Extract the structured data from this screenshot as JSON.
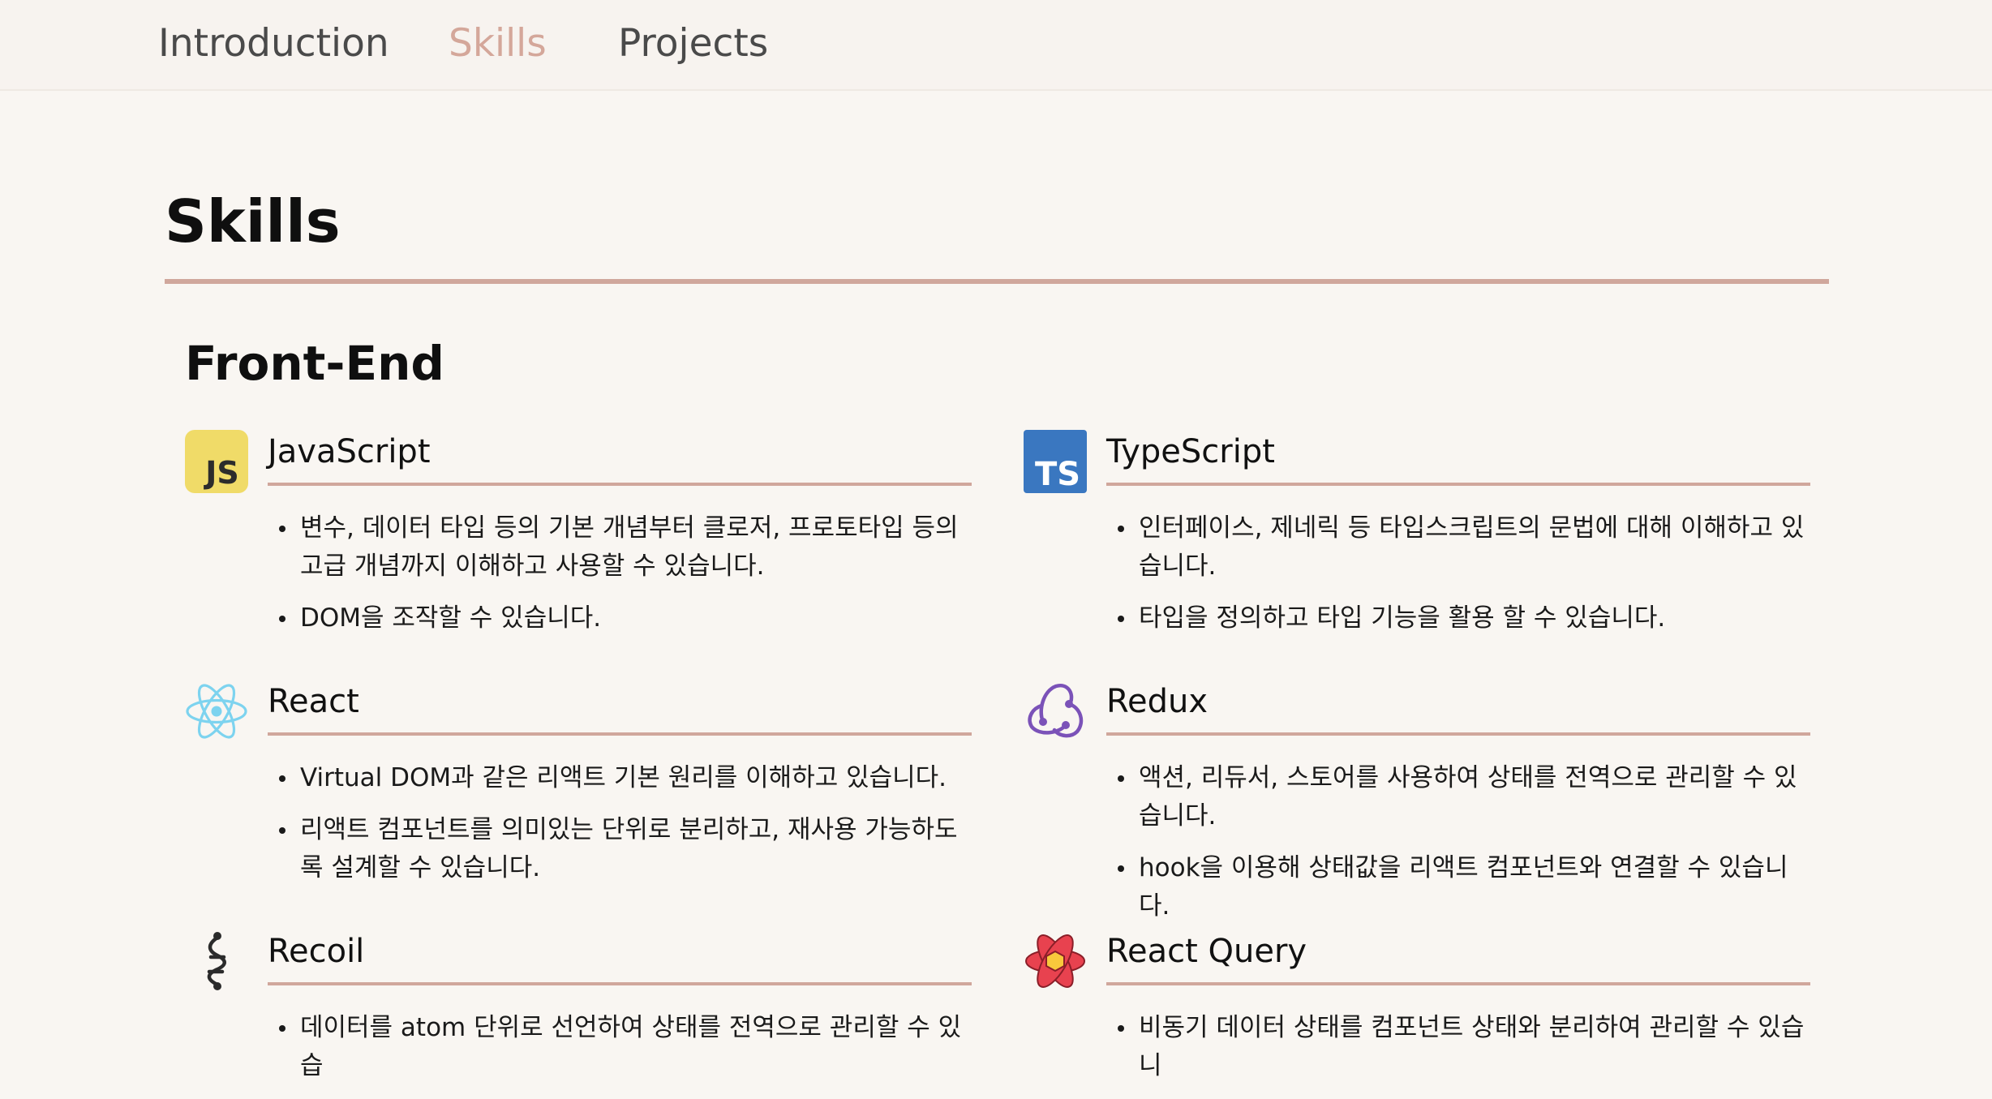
{
  "nav": {
    "items": [
      {
        "label": "Introduction"
      },
      {
        "label": "Skills"
      },
      {
        "label": "Projects"
      }
    ],
    "active_index": 1,
    "active_color": "#d4a79a"
  },
  "page": {
    "title": "Skills",
    "accent_color": "#d0a79c"
  },
  "sections": [
    {
      "title": "Front-End",
      "skills": [
        {
          "name": "JavaScript",
          "icon": "javascript-icon",
          "bullets": [
            "변수, 데이터 타입 등의 기본 개념부터 클로저, 프로토타입 등의 고급 개념까지 이해하고 사용할 수 있습니다.",
            "DOM을 조작할 수 있습니다."
          ]
        },
        {
          "name": "TypeScript",
          "icon": "typescript-icon",
          "bullets": [
            "인터페이스, 제네릭 등 타입스크립트의 문법에 대해 이해하고 있습니다.",
            "타입을 정의하고 타입 기능을 활용 할 수 있습니다."
          ]
        },
        {
          "name": "React",
          "icon": "react-icon",
          "bullets": [
            "Virtual DOM과 같은 리액트 기본 원리를 이해하고 있습니다.",
            "리액트 컴포넌트를 의미있는 단위로 분리하고, 재사용 가능하도록 설계할 수 있습니다."
          ]
        },
        {
          "name": "Redux",
          "icon": "redux-icon",
          "bullets": [
            "액션, 리듀서, 스토어를 사용하여 상태를 전역으로 관리할 수 있습니다.",
            "hook을 이용해 상태값을 리액트 컴포넌트와 연결할 수 있습니다."
          ]
        },
        {
          "name": "Recoil",
          "icon": "recoil-icon",
          "bullets": [
            "데이터를 atom 단위로 선언하여 상태를 전역으로 관리할 수 있습"
          ]
        },
        {
          "name": "React Query",
          "icon": "react-query-icon",
          "bullets": [
            "비동기 데이터 상태를 컴포넌트 상태와 분리하여 관리할 수 있습니"
          ]
        }
      ]
    }
  ]
}
